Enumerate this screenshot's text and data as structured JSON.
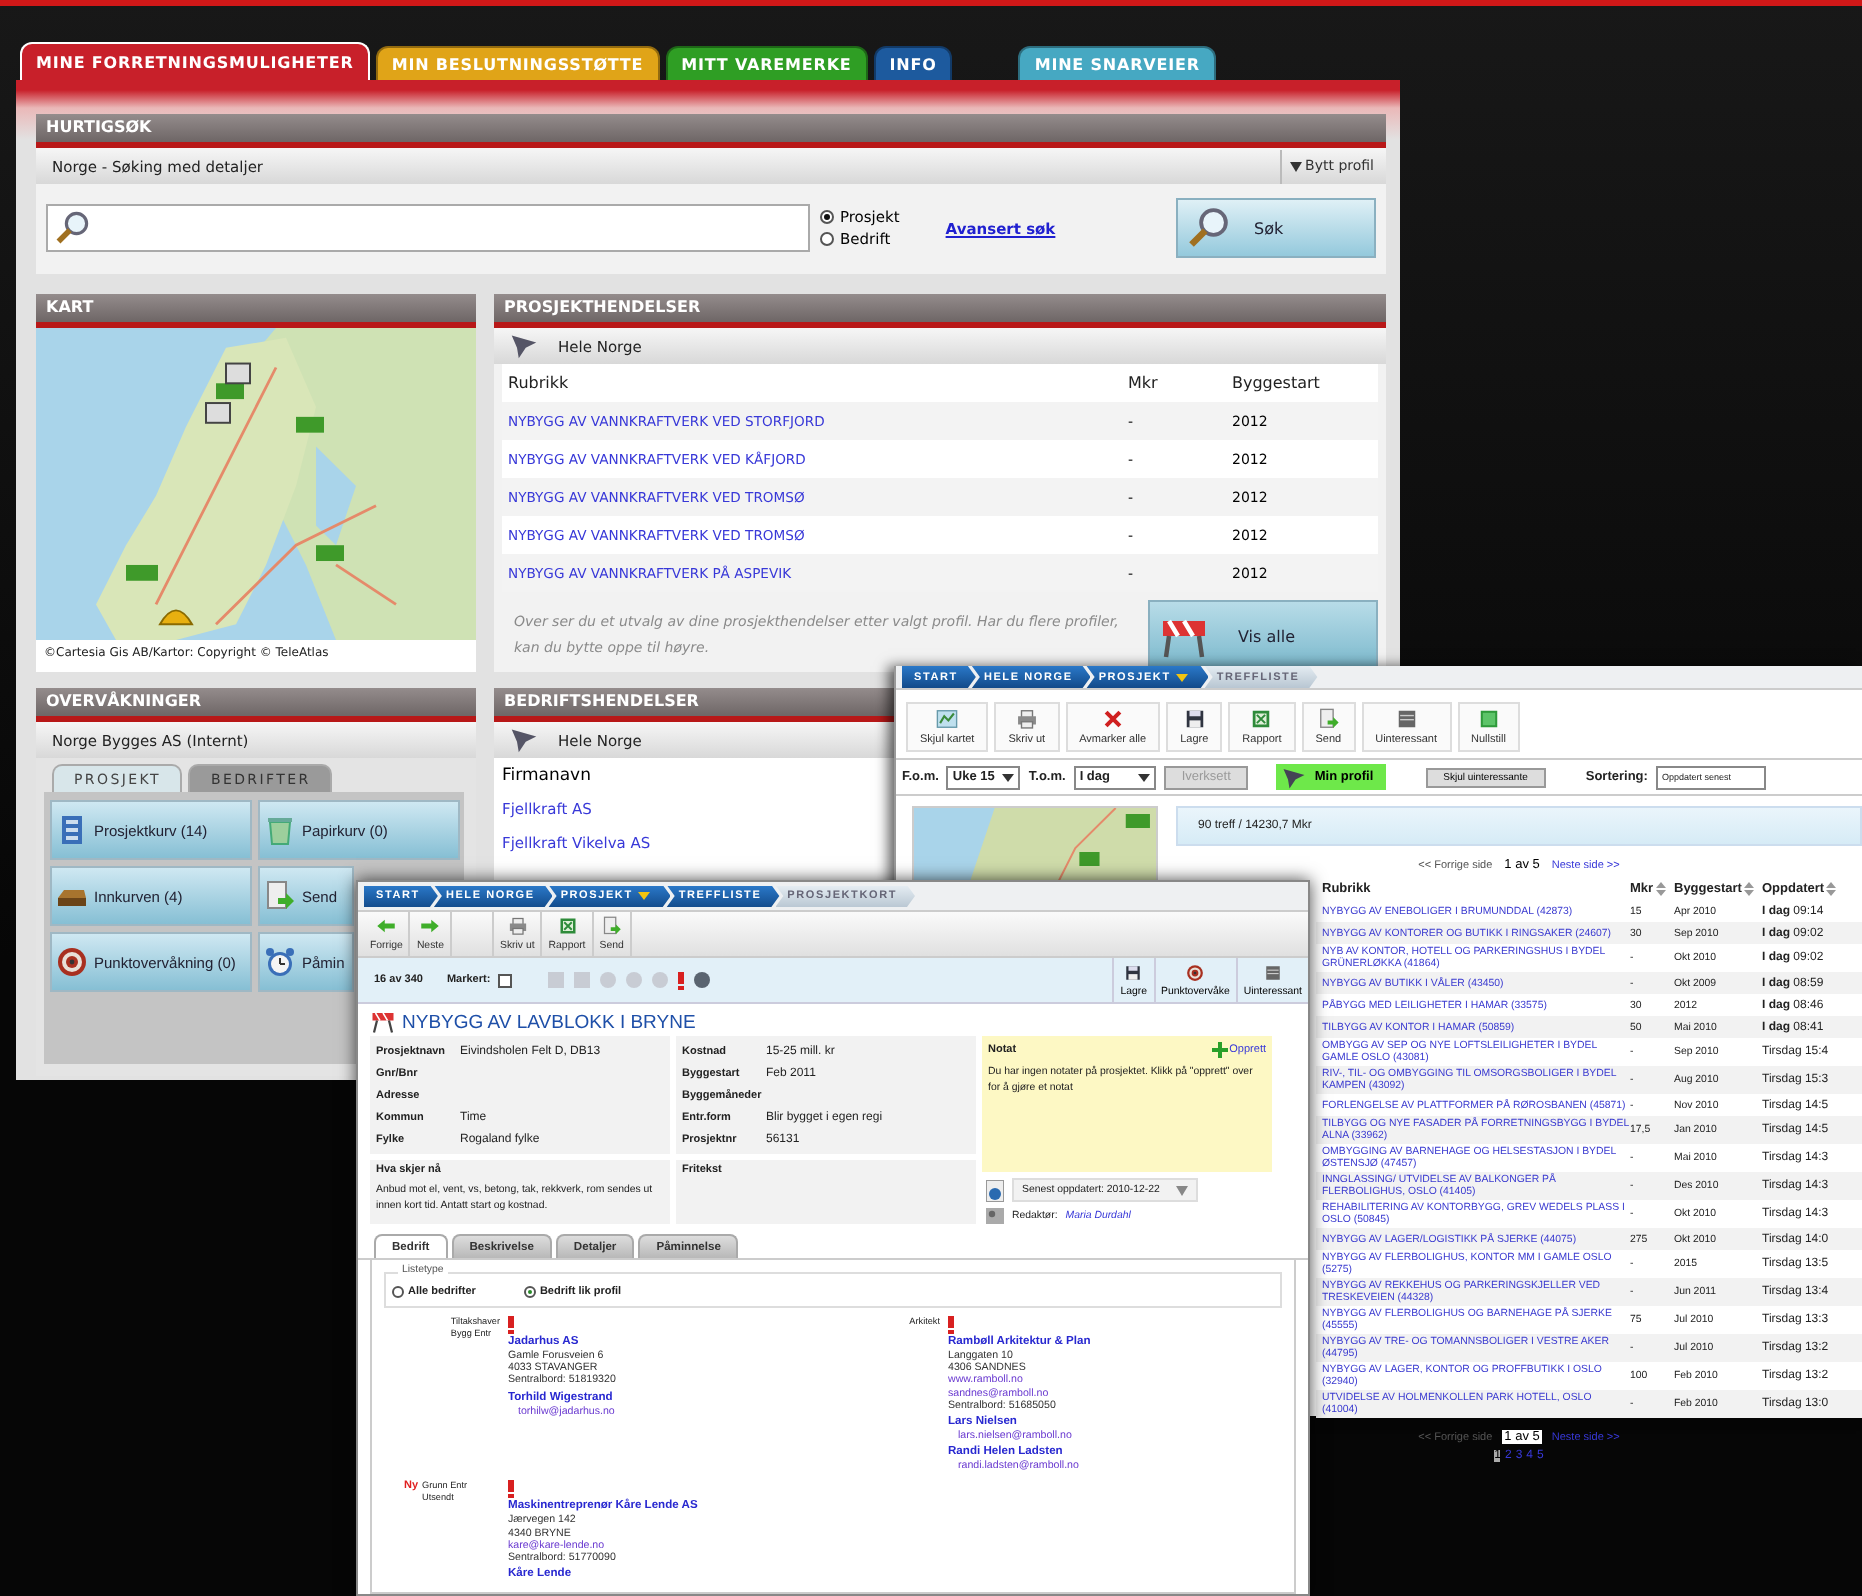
{
  "top_tabs": [
    {
      "label": "MINE FORRETNINGSMULIGHETER",
      "selected": true,
      "color": "#c8202a"
    },
    {
      "label": "MIN BESLUTNINGSSTØTTE",
      "selected": false,
      "color": "#e0a418"
    },
    {
      "label": "MITT VAREMERKE",
      "selected": false,
      "color": "#2f9e24"
    },
    {
      "label": "INFO",
      "selected": false,
      "color": "#1d5a9e"
    },
    {
      "label": "MINE SNARVEIER",
      "selected": false,
      "color": "#46a8c2"
    }
  ],
  "quick_search": {
    "title": "HURTIGSØK",
    "profile": "Norge - Søking med detaljer",
    "switch_profile": "Bytt profil",
    "types": [
      {
        "label": "Prosjekt",
        "selected": true
      },
      {
        "label": "Bedrift",
        "selected": false
      }
    ],
    "advanced_link": "Avansert søk",
    "search_button": "Søk"
  },
  "map_panel": {
    "title": "KART",
    "copyright": "©Cartesia Gis AB/Kartor: Copyright © TeleAtlas"
  },
  "project_events": {
    "title": "PROSJEKTHENDELSER",
    "region": "Hele Norge",
    "columns": [
      "Rubrikk",
      "Mkr",
      "Byggestart"
    ],
    "rows": [
      {
        "title": "NYBYGG AV VANNKRAFTVERK VED STORFJORD",
        "mkr": "-",
        "start": "2012"
      },
      {
        "title": "NYBYGG AV VANNKRAFTVERK VED KÅFJORD",
        "mkr": "-",
        "start": "2012"
      },
      {
        "title": "NYBYGG AV VANNKRAFTVERK VED TROMSØ",
        "mkr": "-",
        "start": "2012"
      },
      {
        "title": "NYBYGG AV VANNKRAFTVERK VED TROMSØ",
        "mkr": "-",
        "start": "2012"
      },
      {
        "title": "NYBYGG AV VANNKRAFTVERK PÅ ASPEVIK",
        "mkr": "-",
        "start": "2012"
      }
    ],
    "note": "Over ser du et utvalg av dine prosjekthendelser etter valgt profil. Har du flere profiler, kan du bytte oppe til høyre.",
    "show_all_button": "Vis alle"
  },
  "monitoring": {
    "title": "OVERVÅKNINGER",
    "account": "Norge Bygges AS (Internt)",
    "tabs": [
      {
        "label": "PROSJEKT",
        "selected": true
      },
      {
        "label": "BEDRIFTER",
        "selected": false
      }
    ],
    "items": [
      {
        "kind": "basket",
        "label": "Prosjektkurv (14)"
      },
      {
        "kind": "trash",
        "label": "Papirkurv (0)"
      },
      {
        "kind": "inbox",
        "label": "Innkurven (4)"
      },
      {
        "kind": "send",
        "label": "Send"
      },
      {
        "kind": "target",
        "label": "Punktovervåkning (0)"
      },
      {
        "kind": "alarm",
        "label": "Påmin"
      }
    ]
  },
  "company_events": {
    "title": "BEDRIFTSHENDELSER",
    "region": "Hele Norge",
    "column": "Firmanavn",
    "rows": [
      "Fjellkraft AS",
      "Fjellkraft Vikelva AS"
    ]
  },
  "hit_list": {
    "breadcrumb": [
      {
        "label": "START",
        "dropdown": false,
        "selected": false
      },
      {
        "label": "HELE NORGE",
        "dropdown": false,
        "selected": false
      },
      {
        "label": "PROSJEKT",
        "dropdown": true,
        "selected": false
      },
      {
        "label": "TREFFLISTE",
        "dropdown": false,
        "selected": true
      }
    ],
    "toolbar": [
      {
        "kind": "map",
        "label": "Skjul kartet"
      },
      {
        "kind": "print",
        "label": "Skriv ut"
      },
      {
        "kind": "unmark",
        "label": "Avmarker alle"
      },
      {
        "kind": "save",
        "label": "Lagre"
      },
      {
        "kind": "report",
        "label": "Rapport"
      },
      {
        "kind": "send",
        "label": "Send"
      },
      {
        "kind": "hide",
        "label": "Uinteressant"
      },
      {
        "kind": "reset",
        "label": "Nullstill"
      }
    ],
    "from_label": "F.o.m.",
    "from_value": "Uke 15",
    "to_label": "T.o.m.",
    "to_value": "I dag",
    "apply_button": "Iverksett",
    "apply_disabled": true,
    "profile_button": "Min profil",
    "hide_button": "Skjul uinteressante",
    "sort_label": "Sortering:",
    "sort_value": "Oppdatert senest",
    "summary": "90 treff / 14230,7 Mkr",
    "pager_top": {
      "prev": "<< Forrige side",
      "pos": "1 av 5",
      "next": "Neste side >>"
    },
    "pager_bottom": {
      "prev": "<< Forrige side",
      "pos": "1 av 5",
      "next": "Neste side >>"
    },
    "columns": [
      "Rubrikk",
      "Mkr",
      "Byggestart",
      "Oppdatert"
    ],
    "rows": [
      {
        "title": "NYBYGG AV ENEBOLIGER I BRUMUNDDAL (42873)",
        "mkr": "15",
        "start": "Apr 2010",
        "updated": "**I dag** 09:14"
      },
      {
        "title": "NYBYGG AV KONTORER OG BUTIKK I RINGSAKER (24607)",
        "mkr": "30",
        "start": "Sep 2010",
        "updated": "**I dag** 09:02"
      },
      {
        "title": "NYB AV KONTOR, HOTELL OG PARKERINGSHUS I BYDEL GRÜNERLØKKA (41864)",
        "mkr": "-",
        "start": "Okt 2010",
        "updated": "**I dag** 09:02"
      },
      {
        "title": "NYBYGG AV BUTIKK I VÅLER (43450)",
        "mkr": "-",
        "start": "Okt 2009",
        "updated": "**I dag** 08:59"
      },
      {
        "title": "PÅBYGG MED LEILIGHETER I HAMAR (33575)",
        "mkr": "30",
        "start": "2012",
        "updated": "**I dag** 08:46"
      },
      {
        "title": "TILBYGG AV KONTOR I HAMAR (50859)",
        "mkr": "50",
        "start": "Mai 2010",
        "updated": "**I dag** 08:41"
      },
      {
        "title": "OMBYGG AV SEP OG NYE LOFTSLEILIGHETER I BYDEL GAMLE OSLO (43081)",
        "mkr": "-",
        "start": "Sep 2010",
        "updated": "Tirsdag 15:4"
      },
      {
        "title": "RIV-, TIL- OG OMBYGGING TIL OMSORGSBOLIGER I BYDEL KAMPEN (43092)",
        "mkr": "-",
        "start": "Aug 2010",
        "updated": "Tirsdag 15:3"
      },
      {
        "title": "FORLENGELSE AV PLATTFORMER PÅ RØROSBANEN (45871)",
        "mkr": "-",
        "start": "Nov 2010",
        "updated": "Tirsdag 14:5"
      },
      {
        "title": "TILBYGG OG NYE FASADER PÅ FORRETNINGSBYGG I BYDEL ALNA (33962)",
        "mkr": "17,5",
        "start": "Jan 2010",
        "updated": "Tirsdag 14:5"
      },
      {
        "title": "OMBYGGING AV BARNEHAGE OG HELSESTASJON I BYDEL ØSTENSJØ (47457)",
        "mkr": "-",
        "start": "Mai 2010",
        "updated": "Tirsdag 14:3"
      },
      {
        "title": "INNGLASSING/ UTVIDELSE AV BALKONGER PÅ FLERBOLIGHUS, OSLO (41405)",
        "mkr": "-",
        "start": "Des 2010",
        "updated": "Tirsdag 14:3"
      },
      {
        "title": "REHABILITERING AV KONTORBYGG, GREV WEDELS PLASS I OSLO (50845)",
        "mkr": "-",
        "start": "Okt 2010",
        "updated": "Tirsdag 14:3"
      },
      {
        "title": "NYBYGG AV LAGER/LOGISTIKK PÅ SJERKE (44075)",
        "mkr": "275",
        "start": "Okt 2010",
        "updated": "Tirsdag 14:0"
      },
      {
        "title": "NYBYGG AV FLERBOLIGHUS, KONTOR MM I GAMLE OSLO (5275)",
        "mkr": "-",
        "start": "2015",
        "updated": "Tirsdag 13:5"
      },
      {
        "title": "NYBYGG AV REKKEHUS OG PARKERINGSKJELLER VED TRESKEVEIEN (44328)",
        "mkr": "-",
        "start": "Jun 2011",
        "updated": "Tirsdag 13:4"
      },
      {
        "title": "NYBYGG AV FLERBOLIGHUS OG BARNEHAGE PÅ SJERKE (45555)",
        "mkr": "75",
        "start": "Jul 2010",
        "updated": "Tirsdag 13:3"
      },
      {
        "title": "NYBYGG AV TRE- OG TOMANNSBOLIGER I VESTRE AKER (44795)",
        "mkr": "-",
        "start": "Jul 2010",
        "updated": "Tirsdag 13:2"
      },
      {
        "title": "NYBYGG AV LAGER, KONTOR OG PROFFBUTIKK I OSLO (32940)",
        "mkr": "100",
        "start": "Feb 2010",
        "updated": "Tirsdag 13:2"
      },
      {
        "title": "UTVIDELSE AV HOLMENKOLLEN PARK HOTELL, OSLO (41004)",
        "mkr": "-",
        "start": "Feb 2010",
        "updated": "Tirsdag 13:0"
      }
    ],
    "pages": [
      {
        "label": "1",
        "selected": true
      },
      {
        "label": "2",
        "selected": false
      },
      {
        "label": "3",
        "selected": false
      },
      {
        "label": "4",
        "selected": false
      },
      {
        "label": "5",
        "selected": false
      }
    ]
  },
  "project_card": {
    "breadcrumb": [
      {
        "label": "START",
        "dropdown": false,
        "selected": false
      },
      {
        "label": "HELE NORGE",
        "dropdown": false,
        "selected": false
      },
      {
        "label": "PROSJEKT",
        "dropdown": true,
        "selected": false
      },
      {
        "label": "TREFFLISTE",
        "dropdown": false,
        "selected": false
      },
      {
        "label": "PROSJEKTKORT",
        "dropdown": false,
        "selected": true
      }
    ],
    "toolbar": [
      {
        "kind": "back",
        "label": "Forrige"
      },
      {
        "kind": "forward",
        "label": "Neste"
      },
      {
        "kind": "print",
        "label": "Skriv ut"
      },
      {
        "kind": "report",
        "label": "Rapport"
      },
      {
        "kind": "send",
        "label": "Send"
      }
    ],
    "position": "16 av 340",
    "marked_label": "Markert:",
    "marked": false,
    "actions": [
      {
        "kind": "save",
        "label": "Lagre"
      },
      {
        "kind": "watch",
        "label": "Punktovervåke"
      },
      {
        "kind": "hide",
        "label": "Uinteressant"
      }
    ],
    "title": "NYBYGG AV LAVBLOKK I BRYNE",
    "fields_left": [
      {
        "label": "Prosjektnavn",
        "value": "Eivindsholen Felt D, DB13"
      },
      {
        "label": "Gnr/Bnr"
      },
      {
        "label": "Adresse"
      },
      {
        "label": "Kommun",
        "value": "Time"
      },
      {
        "label": "Fylke",
        "value": "Rogaland fylke"
      }
    ],
    "fields_right": [
      {
        "label": "Kostnad",
        "value": "15-25 mill. kr"
      },
      {
        "label": "Byggestart",
        "value": "Feb 2011"
      },
      {
        "label": "Byggemåneder"
      },
      {
        "label": "Entr.form",
        "value": "Blir bygget i egen regi"
      },
      {
        "label": "Prosjektnr",
        "value": "56131"
      }
    ],
    "what_now_label": "Hva skjer nå",
    "what_now_text": "Anbud mot el, vent, vs, betong, tak, rekkverk, rom sendes ut innen kort tid. Antatt start og kostnad.",
    "free_text_label": "Fritekst",
    "note": {
      "title": "Notat",
      "create": "Opprett",
      "text": "Du har ingen notater på prosjektet. Klikk på \"opprett\" over for å gjøre et notat"
    },
    "updated": "Senest oppdatert: 2010-12-22",
    "editor_label": "Redaktør:",
    "editor": "Maria Durdahl",
    "tabs": [
      {
        "label": "Bedrift",
        "selected": true
      },
      {
        "label": "Beskrivelse",
        "selected": false
      },
      {
        "label": "Detaljer",
        "selected": false
      },
      {
        "label": "Påminnelse",
        "selected": false
      }
    ],
    "list_type": {
      "legend": "Listetype",
      "options": [
        {
          "label": "Alle bedrifter",
          "selected": false
        },
        {
          "label": "Bedrift lik profil",
          "selected": true
        }
      ]
    },
    "companies": [
      {
        "roles": [
          "Tiltakshaver",
          "Bygg Entr"
        ],
        "name": "Jadarhus AS",
        "lines": [
          {
            "kind": "text",
            "text": "Gamle Forusveien 6"
          },
          {
            "kind": "text",
            "text": "4033 STAVANGER"
          },
          {
            "kind": "text",
            "text": "Sentralbord: 51819320"
          }
        ],
        "contacts": [
          {
            "name": "Torhild Wigestrand",
            "email": "torhilw@jadarhus.no"
          }
        ]
      },
      {
        "roles": [
          "Arkitekt"
        ],
        "name": "Rambøll Arkitektur & Plan",
        "lines": [
          {
            "kind": "text",
            "text": "Langgaten 10"
          },
          {
            "kind": "text",
            "text": "4306 SANDNES"
          },
          {
            "kind": "link",
            "text": "www.ramboll.no"
          },
          {
            "kind": "link",
            "text": "sandnes@ramboll.no"
          },
          {
            "kind": "text",
            "text": "Sentralbord: 51685050"
          }
        ],
        "contacts": [
          {
            "name": "Lars Nielsen",
            "email": "lars.nielsen@ramboll.no"
          },
          {
            "name": "Randi Helen Ladsten",
            "email": "randi.ladsten@ramboll.no"
          }
        ]
      },
      {
        "roles": [
          "Grunn Entr Utsendt"
        ],
        "badge": "Ny",
        "name": "Maskinentreprenør Kåre Lende AS",
        "lines": [
          {
            "kind": "text",
            "text": "Jærvegen 142"
          },
          {
            "kind": "text",
            "text": "4340 BRYNE"
          },
          {
            "kind": "link",
            "text": "kare@kare-lende.no"
          },
          {
            "kind": "text",
            "text": "Sentralbord: 51770090"
          }
        ],
        "contacts": [
          {
            "name": "Kåre Lende"
          }
        ]
      }
    ]
  }
}
